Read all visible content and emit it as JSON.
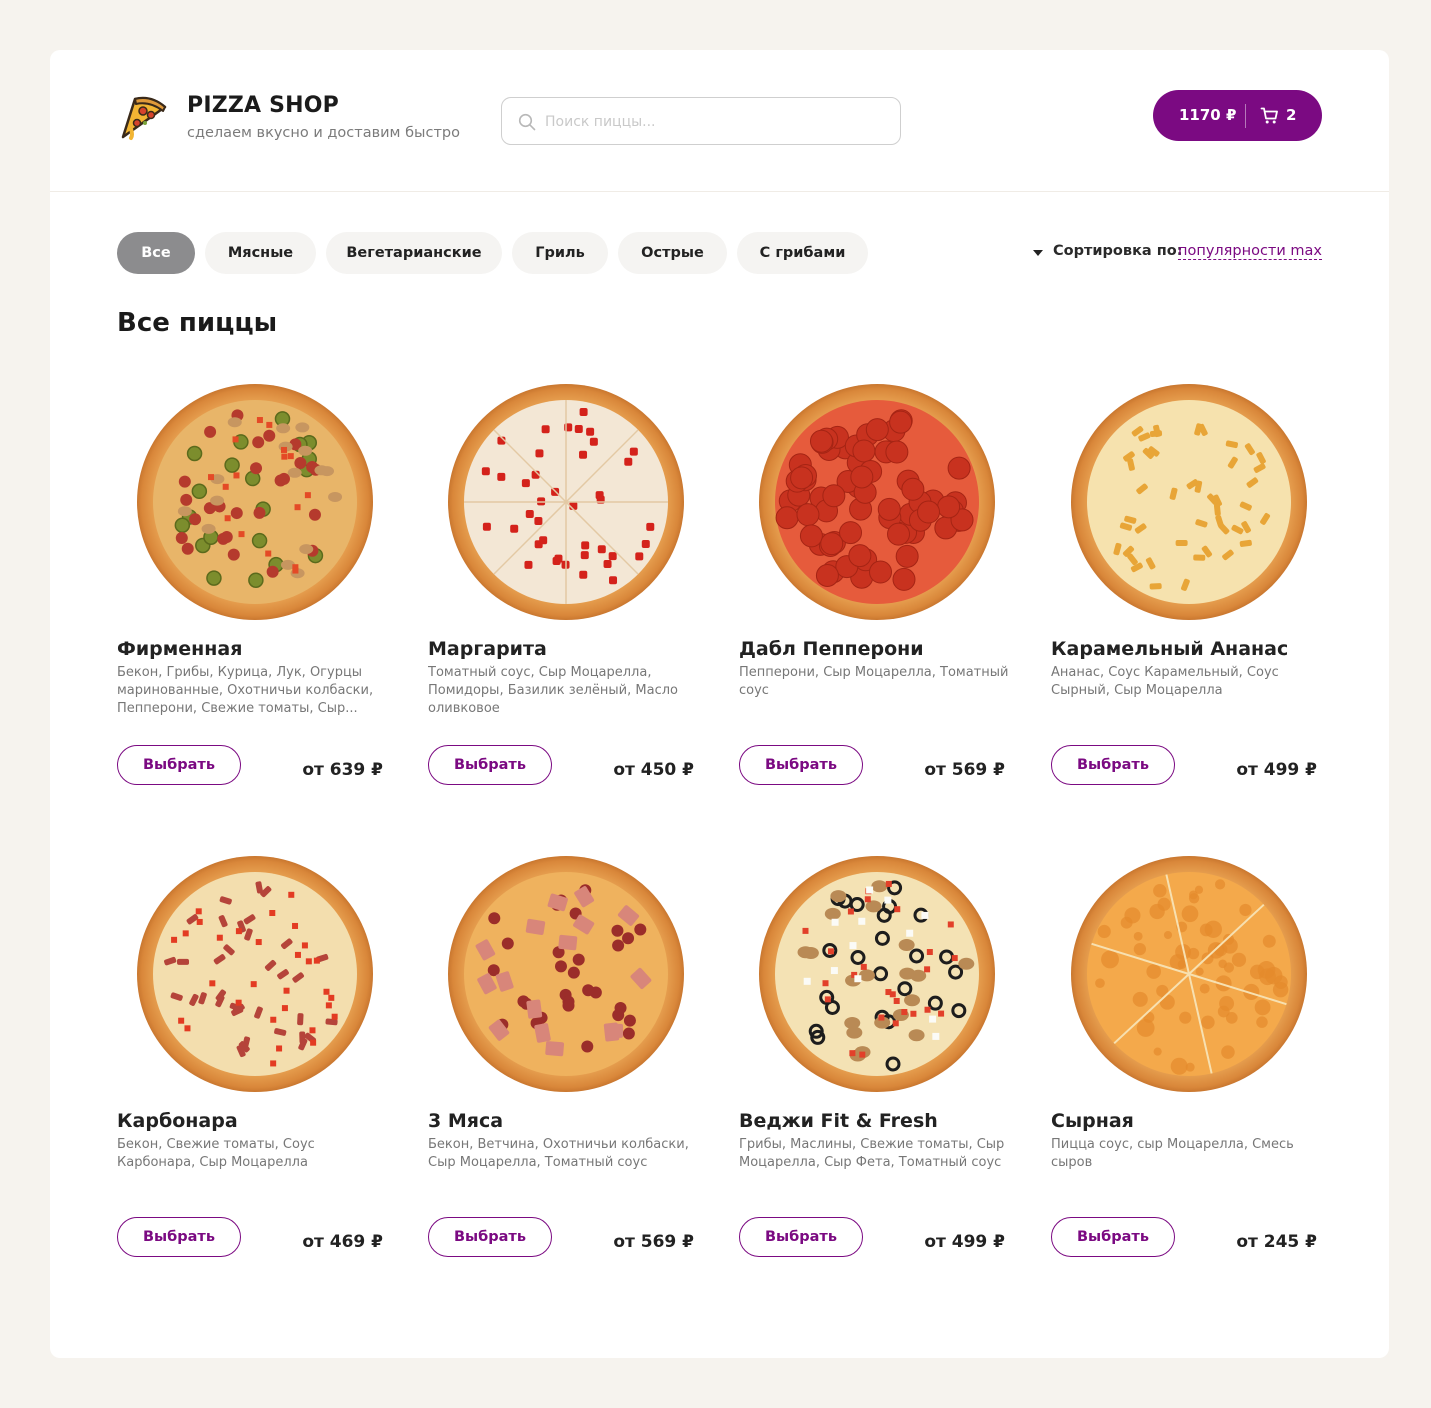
{
  "brand": {
    "title": "PIZZA SHOP",
    "subtitle": "сделаем вкусно и доставим быстро",
    "logo_icon": "pizza-slice-icon"
  },
  "search": {
    "placeholder": "Поиск пиццы...",
    "value": ""
  },
  "cart": {
    "total": "1170 ₽",
    "count": "2",
    "icon": "cart-icon"
  },
  "categories": [
    {
      "label": "Все",
      "active": true
    },
    {
      "label": "Мясные",
      "active": false
    },
    {
      "label": "Вегетарианские",
      "active": false
    },
    {
      "label": "Гриль",
      "active": false
    },
    {
      "label": "Острые",
      "active": false
    },
    {
      "label": "С грибами",
      "active": false
    }
  ],
  "sort": {
    "label": "Сортировка по:",
    "value": "популярности max"
  },
  "section_title": "Все пиццы",
  "select_label": "Выбрать",
  "pizzas": [
    {
      "name": "Фирменная",
      "description": "Бекон, Грибы, Курица, Лук, Огурцы маринованные, Охотничьи колбаски, Пепперони, Свежие томаты, Сыр...",
      "price": "от 639 ₽",
      "style": "mixed"
    },
    {
      "name": "Маргарита",
      "description": "Томатный соус, Сыр Моцарелла, Помидоры, Базилик зелёный, Масло оливковое",
      "price": "от 450 ₽",
      "style": "margherita"
    },
    {
      "name": "Дабл Пепперони",
      "description": "Пепперони, Сыр Моцарелла, Томатный соус",
      "price": "от 569 ₽",
      "style": "pepperoni"
    },
    {
      "name": "Карамельный Ананас",
      "description": "Ананас, Соус Карамельный, Соус Сырный, Сыр Моцарелла",
      "price": "от 499 ₽",
      "style": "pineapple"
    },
    {
      "name": "Карбонара",
      "description": "Бекон, Свежие томаты, Соус Карбонара, Сыр Моцарелла",
      "price": "от 469 ₽",
      "style": "carbonara"
    },
    {
      "name": "3 Мяса",
      "description": "Бекон, Ветчина, Охотничьи колбаски, Сыр Моцарелла, Томатный соус",
      "price": "от 569 ₽",
      "style": "meat"
    },
    {
      "name": "Веджи Fit & Fresh",
      "description": "Грибы, Маслины, Свежие томаты, Сыр Моцарелла, Сыр Фета, Томатный соус",
      "price": "от 499 ₽",
      "style": "veggie"
    },
    {
      "name": "Сырная",
      "description": "Пицца соус, сыр Моцарелла, Смесь сыров",
      "price": "от 245 ₽",
      "style": "cheese"
    }
  ],
  "colors": {
    "accent": "#7b0a82",
    "active_category": "#8c8c8e",
    "page_bg": "#f6f3ee"
  }
}
